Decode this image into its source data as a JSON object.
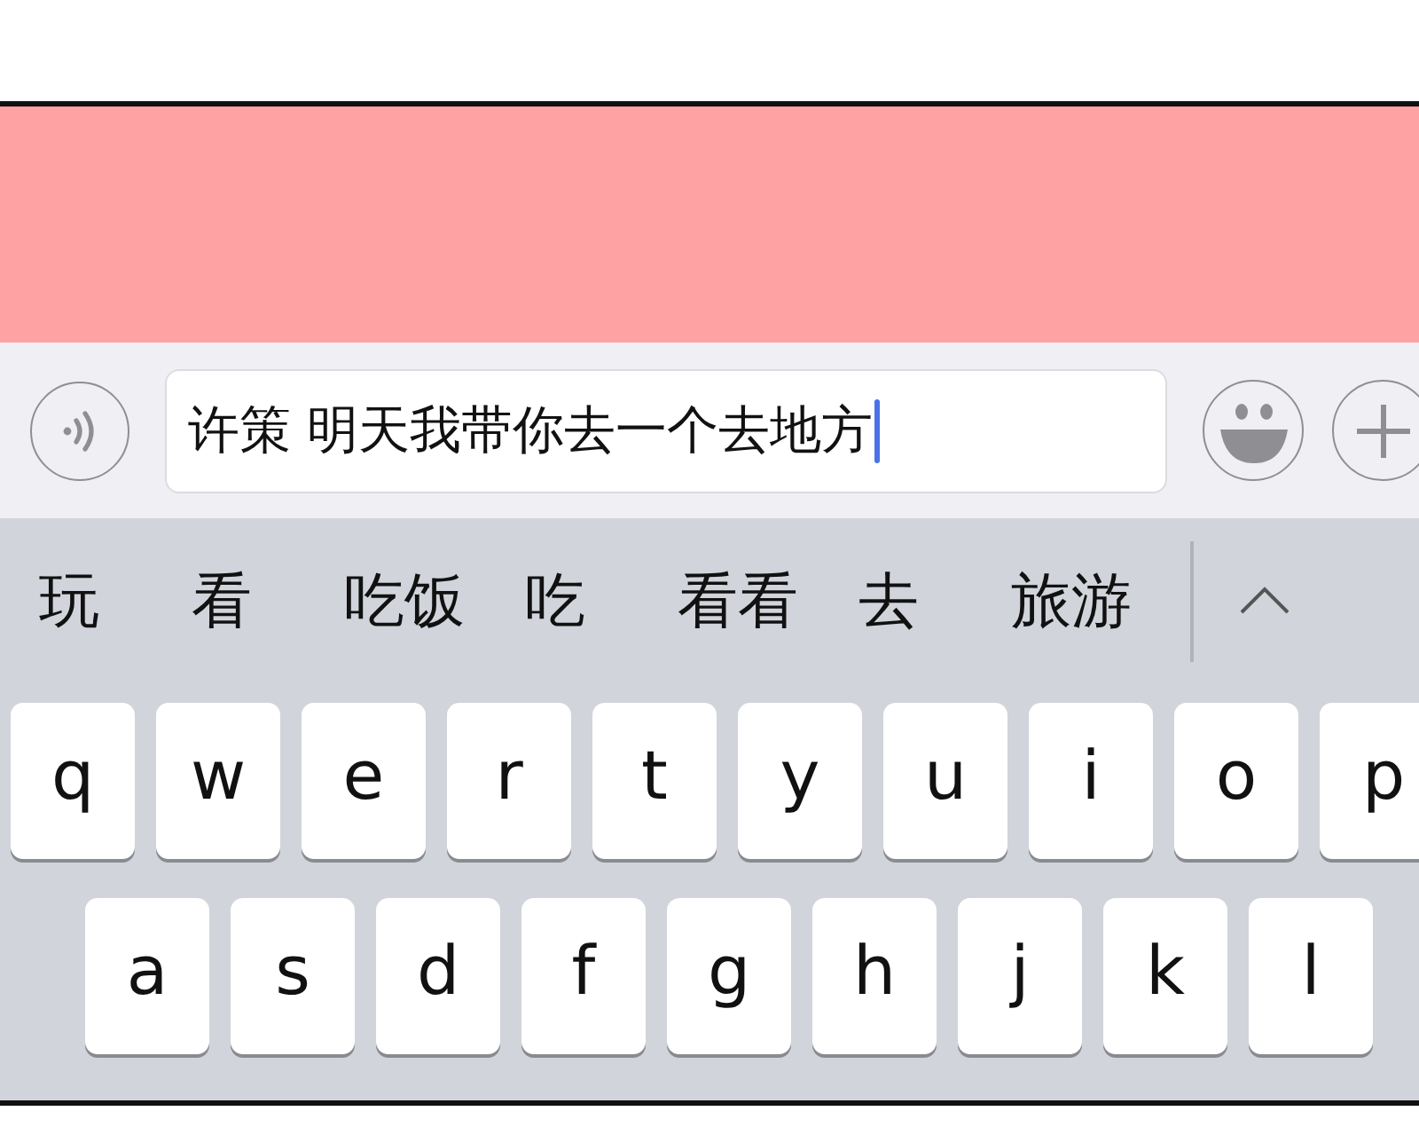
{
  "input_bar": {
    "message_field": {
      "value": "许策 明天我带你去一个去地方",
      "cursor_visible": true
    }
  },
  "candidates": [
    "玩",
    "看",
    "吃饭",
    "吃",
    "看看",
    "去",
    "旅游"
  ],
  "keyboard": {
    "rows": [
      [
        "q",
        "w",
        "e",
        "r",
        "t",
        "y",
        "u",
        "i",
        "o",
        "p"
      ],
      [
        "a",
        "s",
        "d",
        "f",
        "g",
        "h",
        "j",
        "k",
        "l"
      ]
    ]
  }
}
